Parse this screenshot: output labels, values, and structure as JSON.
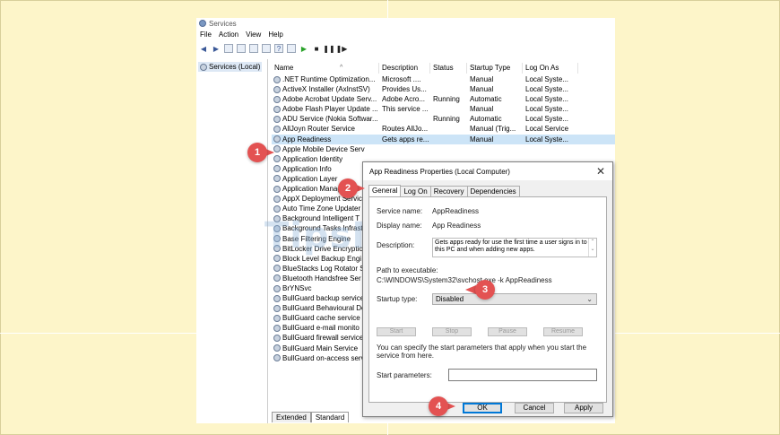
{
  "window": {
    "title": "Services"
  },
  "menu": [
    "File",
    "Action",
    "View",
    "Help"
  ],
  "left_pane": {
    "node_label": "Services (Local)"
  },
  "columns": [
    "Name",
    "Description",
    "Status",
    "Startup Type",
    "Log On As"
  ],
  "rows": [
    {
      "name": ".NET Runtime Optimization...",
      "desc": "Microsoft ....",
      "status": "",
      "startup": "Manual",
      "logon": "Local Syste..."
    },
    {
      "name": "ActiveX Installer (AxInstSV)",
      "desc": "Provides Us...",
      "status": "",
      "startup": "Manual",
      "logon": "Local Syste..."
    },
    {
      "name": "Adobe Acrobat Update Serv...",
      "desc": "Adobe Acro...",
      "status": "Running",
      "startup": "Automatic",
      "logon": "Local Syste..."
    },
    {
      "name": "Adobe Flash Player Update ...",
      "desc": "This service ...",
      "status": "",
      "startup": "Manual",
      "logon": "Local Syste..."
    },
    {
      "name": "ADU Service (Nokia Softwar...",
      "desc": "",
      "status": "Running",
      "startup": "Automatic",
      "logon": "Local Syste..."
    },
    {
      "name": "AllJoyn Router Service",
      "desc": "Routes AllJo...",
      "status": "",
      "startup": "Manual (Trig...",
      "logon": "Local Service"
    },
    {
      "name": "App Readiness",
      "desc": "Gets apps re...",
      "status": "",
      "startup": "Manual",
      "logon": "Local Syste...",
      "selected": true
    },
    {
      "name": "Apple Mobile Device Serv",
      "desc": "",
      "status": "",
      "startup": "",
      "logon": ""
    },
    {
      "name": "Application Identity",
      "desc": "",
      "status": "",
      "startup": "",
      "logon": ""
    },
    {
      "name": "Application Info",
      "desc": "",
      "status": "",
      "startup": "",
      "logon": ""
    },
    {
      "name": "Application Layer",
      "desc": "",
      "status": "",
      "startup": "",
      "logon": ""
    },
    {
      "name": "Application Managemen",
      "desc": "",
      "status": "",
      "startup": "",
      "logon": ""
    },
    {
      "name": "AppX Deployment Servic",
      "desc": "",
      "status": "",
      "startup": "",
      "logon": ""
    },
    {
      "name": "Auto Time Zone Updater",
      "desc": "",
      "status": "",
      "startup": "",
      "logon": ""
    },
    {
      "name": "Background Intelligent T",
      "desc": "",
      "status": "",
      "startup": "",
      "logon": ""
    },
    {
      "name": "Background Tasks Infrast",
      "desc": "",
      "status": "",
      "startup": "",
      "logon": ""
    },
    {
      "name": "Base Filtering Engine",
      "desc": "",
      "status": "",
      "startup": "",
      "logon": ""
    },
    {
      "name": "BitLocker Drive Encryptic",
      "desc": "",
      "status": "",
      "startup": "",
      "logon": ""
    },
    {
      "name": "Block Level Backup Engi",
      "desc": "",
      "status": "",
      "startup": "",
      "logon": ""
    },
    {
      "name": "BlueStacks Log Rotator S",
      "desc": "",
      "status": "",
      "startup": "",
      "logon": ""
    },
    {
      "name": "Bluetooth Handsfree Ser",
      "desc": "",
      "status": "",
      "startup": "",
      "logon": ""
    },
    {
      "name": "BrYNSvc",
      "desc": "",
      "status": "",
      "startup": "",
      "logon": ""
    },
    {
      "name": "BullGuard backup service",
      "desc": "",
      "status": "",
      "startup": "",
      "logon": ""
    },
    {
      "name": "BullGuard Behavioural De",
      "desc": "",
      "status": "",
      "startup": "",
      "logon": ""
    },
    {
      "name": "BullGuard cache service",
      "desc": "",
      "status": "",
      "startup": "",
      "logon": ""
    },
    {
      "name": "BullGuard e-mail monito",
      "desc": "",
      "status": "",
      "startup": "",
      "logon": ""
    },
    {
      "name": "BullGuard firewall service",
      "desc": "",
      "status": "",
      "startup": "",
      "logon": ""
    },
    {
      "name": "BullGuard Main Service",
      "desc": "",
      "status": "",
      "startup": "",
      "logon": ""
    },
    {
      "name": "BullGuard on-access serv",
      "desc": "",
      "status": "",
      "startup": "",
      "logon": ""
    }
  ],
  "bottom_tabs": [
    "Extended",
    "Standard"
  ],
  "dialog": {
    "title": "App Readiness Properties (Local Computer)",
    "close": "✕",
    "tabs": [
      "General",
      "Log On",
      "Recovery",
      "Dependencies"
    ],
    "service_name_label": "Service name:",
    "service_name": "AppReadiness",
    "display_name_label": "Display name:",
    "display_name": "App Readiness",
    "description_label": "Description:",
    "description": "Gets apps ready for use the first time a user signs in to this PC and when adding new apps.",
    "path_label": "Path to executable:",
    "path": "C:\\WINDOWS\\System32\\svchost.exe -k AppReadiness",
    "startup_type_label": "Startup type:",
    "startup_type": "Disabled",
    "service_buttons": [
      "Start",
      "Stop",
      "Pause",
      "Resume"
    ],
    "help_text": "You can specify the start parameters that apply when you start the service from here.",
    "start_params_label": "Start parameters:",
    "ok": "OK",
    "cancel": "Cancel",
    "apply": "Apply"
  },
  "steps": [
    "1",
    "2",
    "3",
    "4"
  ],
  "watermark": "TipsMake",
  "colors": {
    "badge": "#e35252",
    "selection": "#cce4f7",
    "background": "#fdf5c9"
  }
}
